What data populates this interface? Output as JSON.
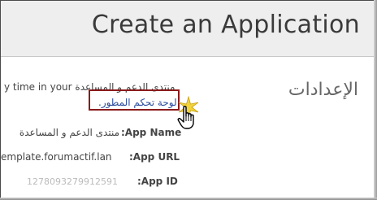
{
  "header": {
    "title": "Create an Application"
  },
  "settings": {
    "heading": "الإعدادات"
  },
  "description": {
    "text_fragment": "y time in your",
    "forum_name": "منتدى الدعم و المساعدة",
    "developer_link": "لوحة تحكم المطور."
  },
  "fields": [
    {
      "label": ":App Name",
      "value": "منتدى الدعم و المساعدة"
    },
    {
      "label": ":App URL",
      "value": "emplate.forumactif.lan"
    },
    {
      "label": ":App ID",
      "value": "1278093279912591"
    }
  ],
  "icons": {
    "cursor": "hand-pointer-icon",
    "sparkle": "click-sparkle-icon"
  },
  "colors": {
    "link": "#2a4b9b",
    "highlight_box": "#8b1a1a",
    "header_bg": "#eeeeee"
  }
}
